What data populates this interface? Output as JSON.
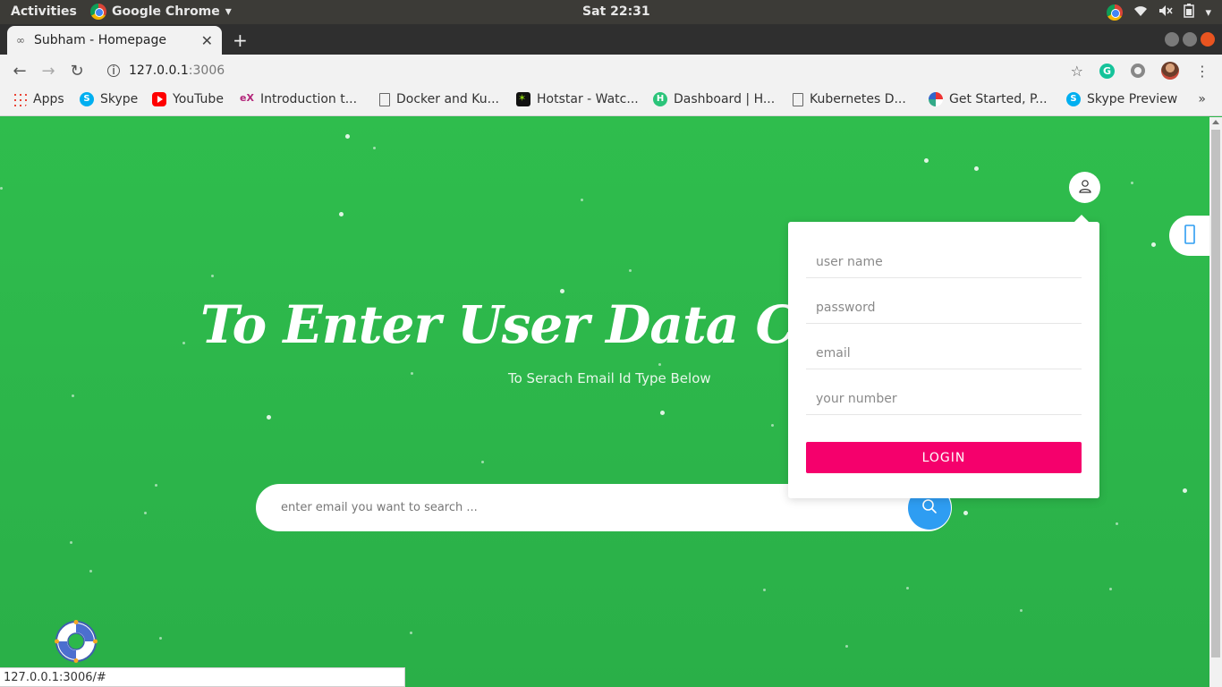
{
  "system": {
    "activities": "Activities",
    "app_name": "Google Chrome",
    "clock": "Sat 22:31"
  },
  "browser": {
    "tab_title": "Subham - Homepage",
    "url_host": "127.0.0.1",
    "url_port": ":3006",
    "bookmarks": [
      {
        "label": "Apps",
        "icon": "apps-grid-icon"
      },
      {
        "label": "Skype",
        "icon": "skype-icon"
      },
      {
        "label": "YouTube",
        "icon": "youtube-icon"
      },
      {
        "label": "Introduction t...",
        "icon": "edx-icon"
      },
      {
        "label": "Docker and Ku...",
        "icon": "document-icon"
      },
      {
        "label": "Hotstar - Watc...",
        "icon": "hotstar-icon"
      },
      {
        "label": "Dashboard | H...",
        "icon": "hackerearth-icon"
      },
      {
        "label": "Kubernetes D...",
        "icon": "document-icon"
      },
      {
        "label": "Get Started, P...",
        "icon": "globe-icon"
      },
      {
        "label": "Skype Preview",
        "icon": "skype-icon"
      }
    ],
    "more": "»",
    "status_url": "127.0.0.1:3006/#"
  },
  "hero": {
    "title": "To Enter User Data Click On",
    "subtitle": "To Serach Email Id Type Below"
  },
  "search": {
    "placeholder": "enter email you want to search ..."
  },
  "login": {
    "username_placeholder": "user name",
    "password_placeholder": "password",
    "email_placeholder": "email",
    "number_placeholder": "your number",
    "button_label": "LOGIN"
  },
  "colors": {
    "page_bg": "#2cb84a",
    "accent_blue": "#2e9df2",
    "login_pink": "#f5006c"
  }
}
